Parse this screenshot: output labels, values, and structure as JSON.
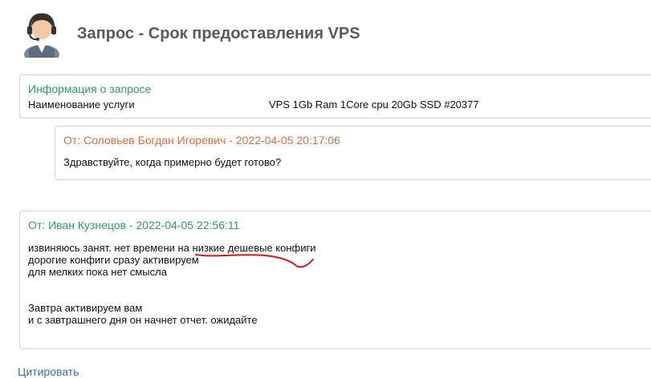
{
  "header": {
    "title": "Запрос - Срок предоставления VPS",
    "avatar_icon": "support-agent-headset-icon"
  },
  "request_info": {
    "heading": "Информация о запросе",
    "field_label": "Наименование услуги",
    "field_value": "VPS 1Gb Ram 1Core cpu 20Gb SSD #20377"
  },
  "messages": [
    {
      "header": "От: Соловьев Богдан Игоревич - 2022-04-05 20:17:06",
      "body": "Здравствуйте, когда примерно будет готово?"
    },
    {
      "header": "От: Иван Кузнецов - 2022-04-05 22:56:11",
      "body": "извиняюсь занят. нет времени на низкие дешевые конфиги\nдорогие конфиги сразу активируем\nдля мелких пока нет смысла\n\n\nЗавтра активируем вам\nи с завтрашнего дня он начнет отчет. ожидайте"
    }
  ],
  "actions": {
    "quote_label": "Цитировать"
  },
  "colors": {
    "staff_accent": "#2e9e5b",
    "client_accent": "#e06d3f",
    "annotation": "#d0191b"
  }
}
